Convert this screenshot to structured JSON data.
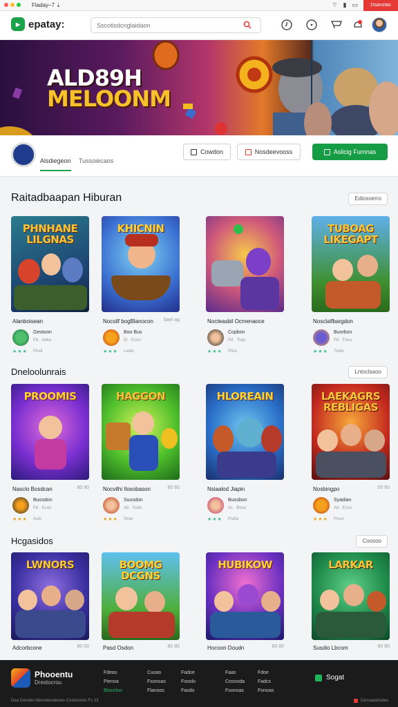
{
  "status": {
    "time": "Fladay‒7 ⇣",
    "right_label": "Dsanotas"
  },
  "header": {
    "brand": "epatay:",
    "search_placeholder": "Sscotisdcnglaidaon"
  },
  "hero": {
    "title_line1": "ALD89H",
    "title_line2": "MELOONM"
  },
  "section_tabs": {
    "tab1": "Alsdiegeon",
    "tab2": "Tussoiecaos",
    "btn1": "Cowdon",
    "btn2": "Nosdeevooss",
    "btn3": "Aslicig Furnnas"
  },
  "sections": [
    {
      "title": "Raitadbaapan Hiburan",
      "see_all": "Ediosoerro",
      "cards": [
        {
          "thumb_title": "PHNHANE LILGNAS",
          "name": "Alanboisean",
          "tag": "",
          "sub1": "Geotoon",
          "sub2": "Pd · Adeo",
          "meta": "Pindi",
          "stars": "★★★",
          "star_style": "teal"
        },
        {
          "thumb_title": "KHICNIN",
          "name": "Nocsilf bogBlanocon",
          "tag": "baei ag",
          "sub1": "Boo Bus",
          "sub2": "Et · Ecoo",
          "meta": "Ladei",
          "stars": "★★★",
          "star_style": "teal"
        },
        {
          "thumb_title": "",
          "name": "Nocteasbil Ocmenaoce",
          "tag": "",
          "sub1": "Copbon",
          "sub2": "Pd · Tsqo",
          "meta": "Ptico",
          "stars": "★★★",
          "star_style": "teal"
        },
        {
          "thumb_title": "TUBOAG LIKEGAPT",
          "name": "Nosclaifbargdon",
          "tag": "",
          "sub1": "Buorbon",
          "sub2": "Pd · Fasu",
          "meta": "Tinde",
          "stars": "★★★",
          "star_style": "teal"
        }
      ]
    },
    {
      "title": "Dneloolunrais",
      "see_all": "Lntoclsaoo",
      "cards": [
        {
          "thumb_title": "PROOMIS",
          "name": "Nasclo Bosdcan",
          "tag": "80 80",
          "sub1": "Buosdon",
          "sub2": "Pd · Ecoo",
          "meta": "Aulo",
          "stars": "★★★",
          "star_style": "gold"
        },
        {
          "thumb_title": "HAGGON",
          "name": "Nocvilhi Ilosobason",
          "tag": "80 60",
          "sub1": "Suosdon",
          "sub2": "Ad · Ssdo",
          "meta": "Sloer",
          "stars": "★★★",
          "star_style": "gold"
        },
        {
          "thumb_title": "HLOREAIN",
          "name": "Nsiaalod Jiapin",
          "tag": "",
          "sub1": "Buosbon",
          "sub2": "Sc · Bouo",
          "meta": "Psdia",
          "stars": "★★★",
          "star_style": "teal"
        },
        {
          "thumb_title": "LAEKAGRS REBLIGAS",
          "name": "Nosbingpo",
          "tag": "00 60",
          "sub1": "Syadian",
          "sub2": "Ad · Ecsu",
          "meta": "Pssoi",
          "stars": "★★★",
          "star_style": "gold"
        }
      ]
    },
    {
      "title": "Hcgasidos",
      "see_all": "Coosoo",
      "cards": [
        {
          "thumb_title": "LWNORS",
          "name": "Adcorbcone",
          "tag": "80 00",
          "sub1": "",
          "sub2": "",
          "meta": "",
          "stars": "",
          "star_style": "teal"
        },
        {
          "thumb_title": "BOOMG DCGNS",
          "name": "Pasd Osdon",
          "tag": "80 80",
          "sub1": "",
          "sub2": "",
          "meta": "",
          "stars": "",
          "star_style": "teal"
        },
        {
          "thumb_title": "HUBIKOW",
          "name": "Hocoon Doudn",
          "tag": "80 80",
          "sub1": "",
          "sub2": "",
          "meta": "",
          "stars": "",
          "star_style": "teal"
        },
        {
          "thumb_title": "LARKAR",
          "name": "Susdio Lbcom",
          "tag": "80 80",
          "sub1": "",
          "sub2": "",
          "meta": "",
          "stars": "",
          "star_style": "teal"
        }
      ]
    }
  ],
  "footer": {
    "brand": "Phooentu",
    "brand_sub": "Drestocrou",
    "col1": [
      "Fdeas",
      "Pienoa",
      "Blasnloo"
    ],
    "col2": [
      "Cuoas",
      "Fsonoas",
      "Flanoos"
    ],
    "col3": [
      "Fadoe",
      "Fosolo",
      "Fasdo"
    ],
    "col4": [
      "Faas",
      "Cosnoda",
      "Fsonoas"
    ],
    "col5": [
      "Fdoe",
      "Fadcs",
      "Fonoas"
    ],
    "cta": "Sogat",
    "bottom": "Dea Geosbo Abensbeodeses   Cosbnsoes Fs 13",
    "bottom_right": "Cencaastrodes"
  }
}
